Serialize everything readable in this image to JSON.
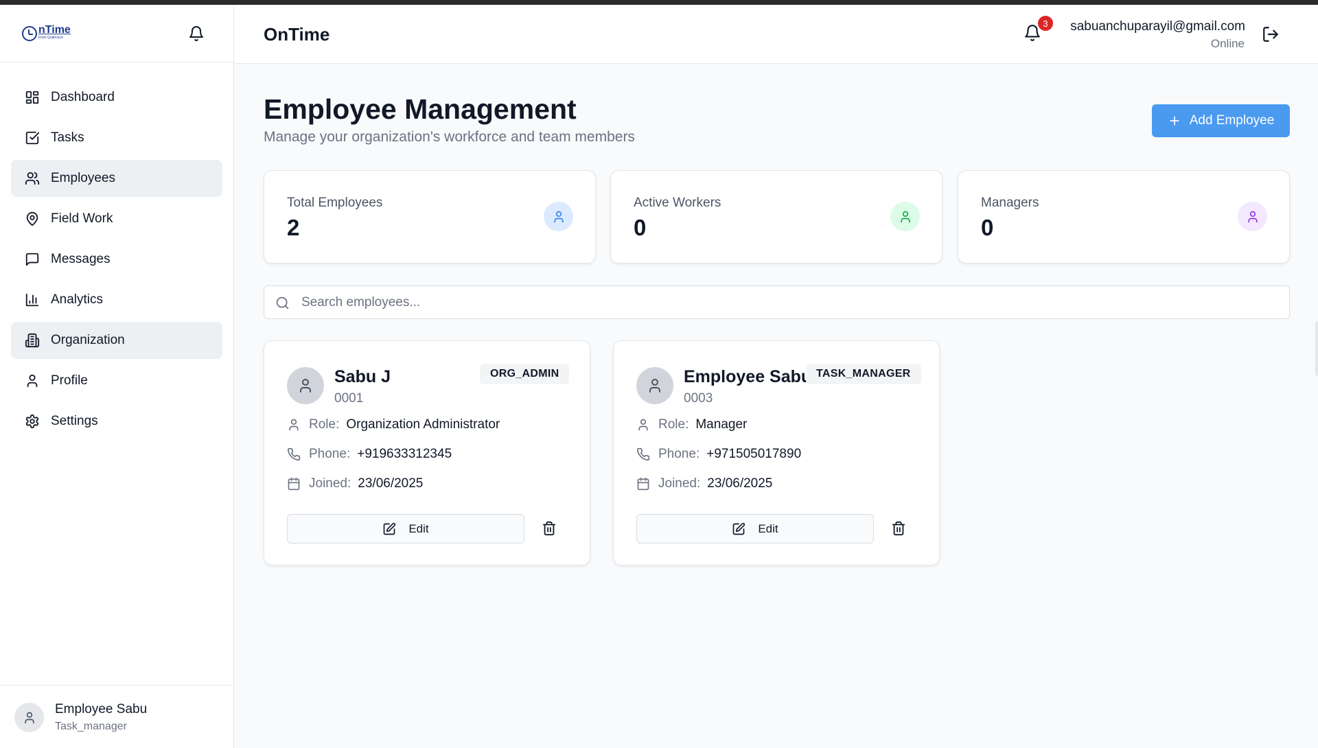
{
  "logo": {
    "main": "nTime",
    "sub": "From QuikForce"
  },
  "sidebar": {
    "items": [
      {
        "label": "Dashboard",
        "icon": "dashboard-icon"
      },
      {
        "label": "Tasks",
        "icon": "tasks-icon"
      },
      {
        "label": "Employees",
        "icon": "users-icon",
        "active": true
      },
      {
        "label": "Field Work",
        "icon": "map-pin-icon"
      },
      {
        "label": "Messages",
        "icon": "message-icon"
      },
      {
        "label": "Analytics",
        "icon": "bar-chart-icon"
      },
      {
        "label": "Organization",
        "icon": "building-icon",
        "active": true
      },
      {
        "label": "Profile",
        "icon": "user-icon"
      },
      {
        "label": "Settings",
        "icon": "gear-icon"
      }
    ],
    "footer": {
      "name": "Employee Sabu",
      "role": "Task_manager"
    }
  },
  "header": {
    "title": "OnTime",
    "notification_count": "3",
    "user_email": "sabuanchuparayil@gmail.com",
    "user_status": "Online"
  },
  "main": {
    "title": "Employee Management",
    "subtitle": "Manage your organization's workforce and team members",
    "add_button": "Add Employee",
    "stats": [
      {
        "label": "Total Employees",
        "value": "2",
        "color": "#3b82f6",
        "bg": "#dbeafe"
      },
      {
        "label": "Active Workers",
        "value": "0",
        "color": "#16a34a",
        "bg": "#dcfce7"
      },
      {
        "label": "Managers",
        "value": "0",
        "color": "#9333ea",
        "bg": "#f3e8ff"
      }
    ],
    "search": {
      "placeholder": "Search employees..."
    },
    "labels": {
      "role": "Role:",
      "phone": "Phone:",
      "joined": "Joined:",
      "edit": "Edit"
    },
    "employees": [
      {
        "name": "Sabu J",
        "id": "0001",
        "badge": "ORG_ADMIN",
        "role": "Organization Administrator",
        "phone": "+919633312345",
        "joined": "23/06/2025"
      },
      {
        "name": "Employee Sabu",
        "id": "0003",
        "badge": "TASK_MANAGER",
        "role": "Manager",
        "phone": "+971505017890",
        "joined": "23/06/2025"
      }
    ]
  },
  "colors": {
    "accent": "#4a9af0",
    "badge_red": "#dc2626"
  }
}
